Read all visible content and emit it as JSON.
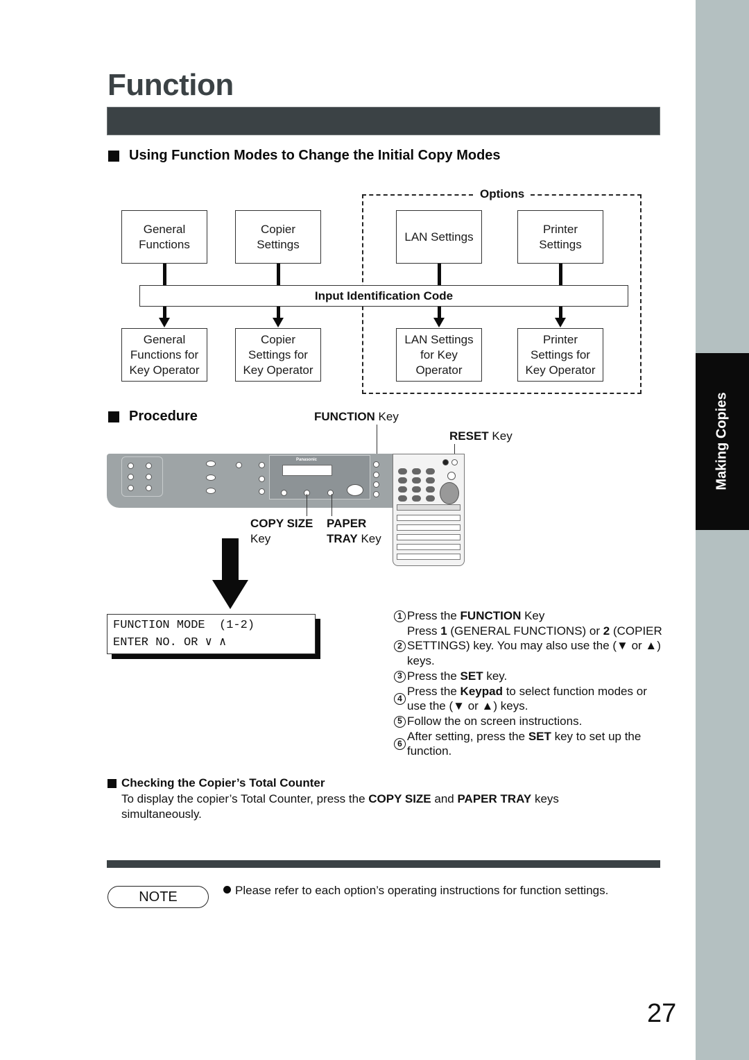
{
  "page": {
    "title": "Function",
    "number": "27",
    "side_tab": "Making Copies"
  },
  "section1": {
    "heading": "Using Function Modes to Change the Initial Copy Modes",
    "diagram": {
      "options_label": "Options",
      "top_boxes": [
        {
          "line1": "General",
          "line2": "Functions"
        },
        {
          "line1": "Copier",
          "line2": "Settings"
        },
        {
          "line1": "LAN Settings",
          "line2": ""
        },
        {
          "line1": "Printer",
          "line2": "Settings"
        }
      ],
      "middle_bar": "Input Identification Code",
      "bottom_boxes": [
        {
          "line1": "General",
          "line2": "Functions for",
          "line3": "Key Operator"
        },
        {
          "line1": "Copier",
          "line2": "Settings for",
          "line3": "Key Operator"
        },
        {
          "line1": "LAN Settings",
          "line2": "for Key",
          "line3": "Operator"
        },
        {
          "line1": "Printer",
          "line2": "Settings for",
          "line3": "Key Operator"
        }
      ]
    }
  },
  "procedure": {
    "heading": "Procedure",
    "callouts": {
      "function_key_bold": "FUNCTION",
      "function_key_rest": " Key",
      "reset_key_bold": "RESET",
      "reset_key_rest": " Key",
      "copy_size_bold": "COPY SIZE",
      "copy_size_rest": "Key",
      "paper_bold": "PAPER",
      "tray_bold": "TRAY",
      "tray_rest": " Key"
    },
    "panel": {
      "brand": "Panasonic"
    },
    "lcd": {
      "line1": "FUNCTION MODE  (1-2)",
      "line2": "ENTER NO. OR ∨ ∧"
    },
    "steps": [
      {
        "num": "1",
        "parts": [
          {
            "t": "Press the "
          },
          {
            "b": "FUNCTION"
          },
          {
            "t": " Key"
          }
        ]
      },
      {
        "num": "2",
        "parts": [
          {
            "t": "Press "
          },
          {
            "b": "1"
          },
          {
            "t": " (GENERAL FUNCTIONS) or "
          },
          {
            "b": "2"
          },
          {
            "t": " (COPIER SETTINGS) key. You may also use the (▼ or ▲) keys."
          }
        ]
      },
      {
        "num": "3",
        "parts": [
          {
            "t": "Press the "
          },
          {
            "b": "SET"
          },
          {
            "t": " key."
          }
        ]
      },
      {
        "num": "4",
        "parts": [
          {
            "t": "Press the "
          },
          {
            "b": "Keypad"
          },
          {
            "t": " to select function modes or use the (▼ or ▲) keys."
          }
        ]
      },
      {
        "num": "5",
        "parts": [
          {
            "t": "Follow the on screen instructions."
          }
        ]
      },
      {
        "num": "6",
        "parts": [
          {
            "t": "After setting, press the "
          },
          {
            "b": "SET"
          },
          {
            "t": " key to set up the function."
          }
        ]
      }
    ]
  },
  "counter": {
    "heading": "Checking the Copier’s Total Counter",
    "text_1": "To display the copier’s Total Counter, press the ",
    "bold_1": "COPY SIZE",
    "text_2": " and ",
    "bold_2": "PAPER TRAY",
    "text_3": " keys simultaneously."
  },
  "note": {
    "label": "NOTE",
    "text": "Please refer to each option’s operating instructions for function settings."
  }
}
